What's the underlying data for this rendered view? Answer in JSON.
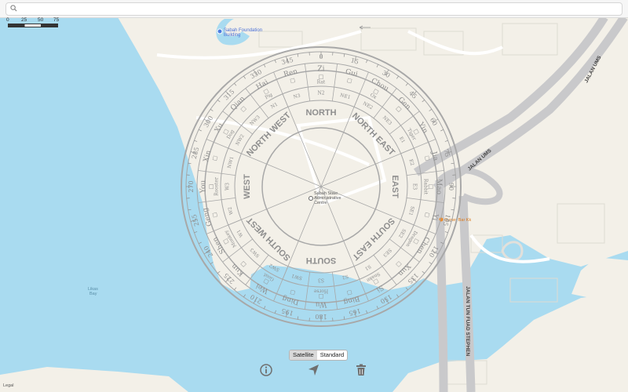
{
  "search": {
    "placeholder": ""
  },
  "scale": {
    "labels": [
      "0",
      "25",
      "50",
      "75 m"
    ]
  },
  "places": {
    "foundation": "Sabah Foundation Building",
    "foundation_l1": "Sabah Foundation",
    "foundation_l2": "Building",
    "admin_l1": "Sabah State",
    "admin_l2": "Administrative",
    "admin_l3": "Centre",
    "oyster": "Oyster Bar Kk",
    "likas_l1": "Likas",
    "likas_l2": "Bay"
  },
  "roads": {
    "ums1": "JALAN UMS",
    "ums2": "JALAN UMS",
    "tun_fuad": "JALAN TUN FUAD STEPHEN"
  },
  "compass": {
    "degrees": [
      "0",
      "15",
      "30",
      "45",
      "60",
      "75",
      "90",
      "105",
      "120",
      "135",
      "150",
      "165",
      "180",
      "195",
      "210",
      "225",
      "240",
      "255",
      "270",
      "285",
      "300",
      "315",
      "330",
      "345"
    ],
    "mountains": [
      {
        "name": "Zi",
        "animal": "Rat"
      },
      {
        "name": "Gui",
        "animal": ""
      },
      {
        "name": "Chou",
        "animal": "Ox"
      },
      {
        "name": "Gen",
        "animal": ""
      },
      {
        "name": "Yin",
        "animal": "Tiger"
      },
      {
        "name": "Jia",
        "animal": ""
      },
      {
        "name": "Mao",
        "animal": "Rabbit"
      },
      {
        "name": "Yi",
        "animal": ""
      },
      {
        "name": "Chen",
        "animal": "Dragon"
      },
      {
        "name": "Xun",
        "animal": ""
      },
      {
        "name": "Si",
        "animal": "Snake"
      },
      {
        "name": "Bing",
        "animal": ""
      },
      {
        "name": "Wu",
        "animal": "Horse"
      },
      {
        "name": "Ding",
        "animal": ""
      },
      {
        "name": "Wei",
        "animal": "Goat"
      },
      {
        "name": "Kun",
        "animal": ""
      },
      {
        "name": "Shen",
        "animal": "Monkey"
      },
      {
        "name": "Geng",
        "animal": ""
      },
      {
        "name": "You",
        "animal": "Rooster"
      },
      {
        "name": "Xin",
        "animal": ""
      },
      {
        "name": "Xu",
        "animal": "Dog"
      },
      {
        "name": "Qian",
        "animal": ""
      },
      {
        "name": "Hai",
        "animal": "Pig"
      },
      {
        "name": "Ren",
        "animal": ""
      }
    ],
    "subdirs": [
      "N2",
      "NE1",
      "NE2",
      "NE3",
      "E1",
      "E2",
      "E3",
      "SE1",
      "SE2",
      "SE3",
      "S1",
      "S2",
      "S3",
      "SW1",
      "SW2",
      "SW3",
      "W1",
      "W2",
      "W3",
      "NW1",
      "NW2",
      "NW3",
      "N1",
      "N3"
    ],
    "directions": [
      "NORTH",
      "NORTH EAST",
      "EAST",
      "SOUTH EAST",
      "SOUTH",
      "SOUTH WEST",
      "WEST",
      "NORTH WEST"
    ]
  },
  "toggle": {
    "satellite": "Satellite",
    "standard": "Standard",
    "selected": "Satellite"
  },
  "legal": "Legal",
  "colors": {
    "water": "#a9dbf0",
    "land": "#f3f0e8",
    "road": "#c9c9cb",
    "compass": "#8e8e8e"
  }
}
